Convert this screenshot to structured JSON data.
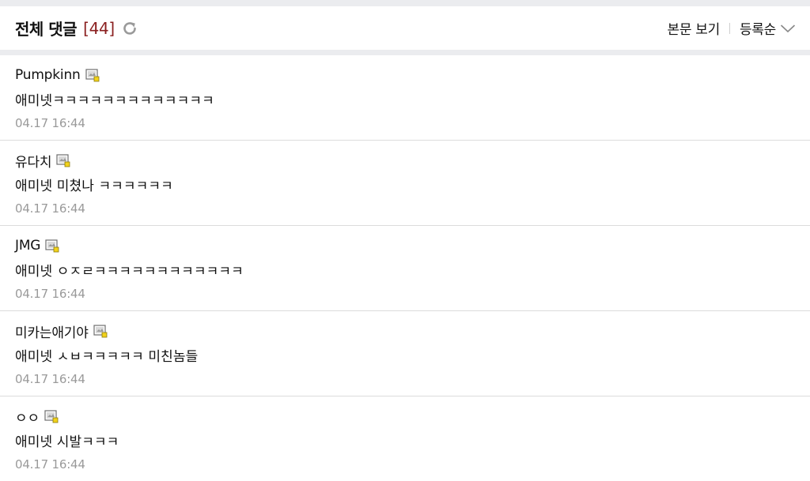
{
  "header": {
    "title": "전체 댓글",
    "count": "[44]",
    "view_post": "본문 보기",
    "sort_label": "등록순"
  },
  "comments": [
    {
      "author": "Pumpkinn",
      "body": "애미넷ㅋㅋㅋㅋㅋㅋㅋㅋㅋㅋㅋㅋㅋ",
      "date": "04.17 16:44"
    },
    {
      "author": "유다치",
      "body": "애미넷 미쳤나 ㅋㅋㅋㅋㅋㅋ",
      "date": "04.17 16:44"
    },
    {
      "author": "JMG",
      "body": "애미넷 ㅇㅈㄹㅋㅋㅋㅋㅋㅋㅋㅋㅋㅋㅋㅋ",
      "date": "04.17 16:44"
    },
    {
      "author": "미카는애기야",
      "body": "애미넷 ㅅㅂㅋㅋㅋㅋㅋ 미친놈들",
      "date": "04.17 16:44"
    },
    {
      "author": "ㅇㅇ",
      "body": "애미넷 시발ㅋㅋㅋ",
      "date": "04.17 16:44"
    }
  ],
  "icons": {
    "refresh": "refresh-icon",
    "sort": "chevron-down-icon",
    "level": "member-level-icon"
  },
  "colors": {
    "count": "#8a1f1f",
    "date": "#9a9a9a",
    "strip": "#ebecef",
    "level_badge": "#f2d21a"
  }
}
